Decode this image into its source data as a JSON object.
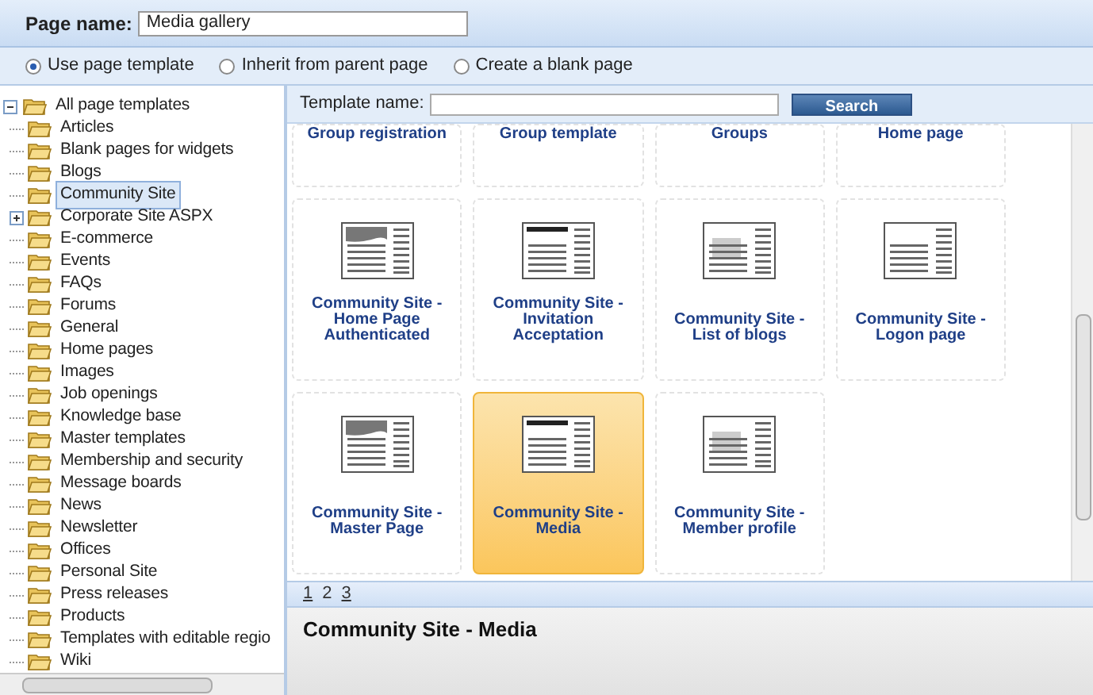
{
  "page_name": {
    "label": "Page name:",
    "value": "Media gallery"
  },
  "options": [
    {
      "label": "Use page template",
      "selected": true
    },
    {
      "label": "Inherit from parent page",
      "selected": false
    },
    {
      "label": "Create a blank page",
      "selected": false
    }
  ],
  "tree": {
    "label": "All page templates",
    "expanded": true,
    "children": [
      {
        "label": "Articles",
        "selected": false
      },
      {
        "label": "Blank pages for widgets",
        "selected": false
      },
      {
        "label": "Blogs",
        "selected": false
      },
      {
        "label": "Community Site",
        "selected": true
      },
      {
        "label": "Corporate Site ASPX",
        "selected": false,
        "expandable": true
      },
      {
        "label": "E-commerce",
        "selected": false
      },
      {
        "label": "Events",
        "selected": false
      },
      {
        "label": "FAQs",
        "selected": false
      },
      {
        "label": "Forums",
        "selected": false
      },
      {
        "label": "General",
        "selected": false
      },
      {
        "label": "Home pages",
        "selected": false
      },
      {
        "label": "Images",
        "selected": false
      },
      {
        "label": "Job openings",
        "selected": false
      },
      {
        "label": "Knowledge base",
        "selected": false
      },
      {
        "label": "Master templates",
        "selected": false
      },
      {
        "label": "Membership and security",
        "selected": false
      },
      {
        "label": "Message boards",
        "selected": false
      },
      {
        "label": "News",
        "selected": false
      },
      {
        "label": "Newsletter",
        "selected": false
      },
      {
        "label": "Offices",
        "selected": false
      },
      {
        "label": "Personal Site",
        "selected": false
      },
      {
        "label": "Press releases",
        "selected": false
      },
      {
        "label": "Products",
        "selected": false
      },
      {
        "label": "Templates with editable regio",
        "selected": false
      },
      {
        "label": "Wiki",
        "selected": false
      }
    ]
  },
  "search": {
    "label": "Template name:",
    "button": "Search"
  },
  "templates": [
    {
      "title": "Group registration",
      "selected": false,
      "kind": "partial"
    },
    {
      "title": "Group template",
      "selected": false,
      "kind": "partial"
    },
    {
      "title": "Groups",
      "selected": false,
      "kind": "partial"
    },
    {
      "title": "Home page",
      "selected": false,
      "kind": "partial"
    },
    {
      "title": "Community Site - Home Page Authenticated",
      "selected": false,
      "kind": "full"
    },
    {
      "title": "Community Site - Invitation Acceptation",
      "selected": false,
      "kind": "full"
    },
    {
      "title": "Community Site - List of blogs",
      "selected": false,
      "kind": "full"
    },
    {
      "title": "Community Site - Logon page",
      "selected": false,
      "kind": "full"
    },
    {
      "title": "Community Site - Master Page",
      "selected": false,
      "kind": "full"
    },
    {
      "title": "Community Site - Media",
      "selected": true,
      "kind": "full"
    },
    {
      "title": "Community Site - Member profile",
      "selected": false,
      "kind": "full"
    }
  ],
  "pages": [
    {
      "label": "1",
      "selected": false
    },
    {
      "label": "2",
      "selected": true
    },
    {
      "label": "3",
      "selected": false
    }
  ],
  "preview": {
    "title": "Community Site - Media"
  }
}
